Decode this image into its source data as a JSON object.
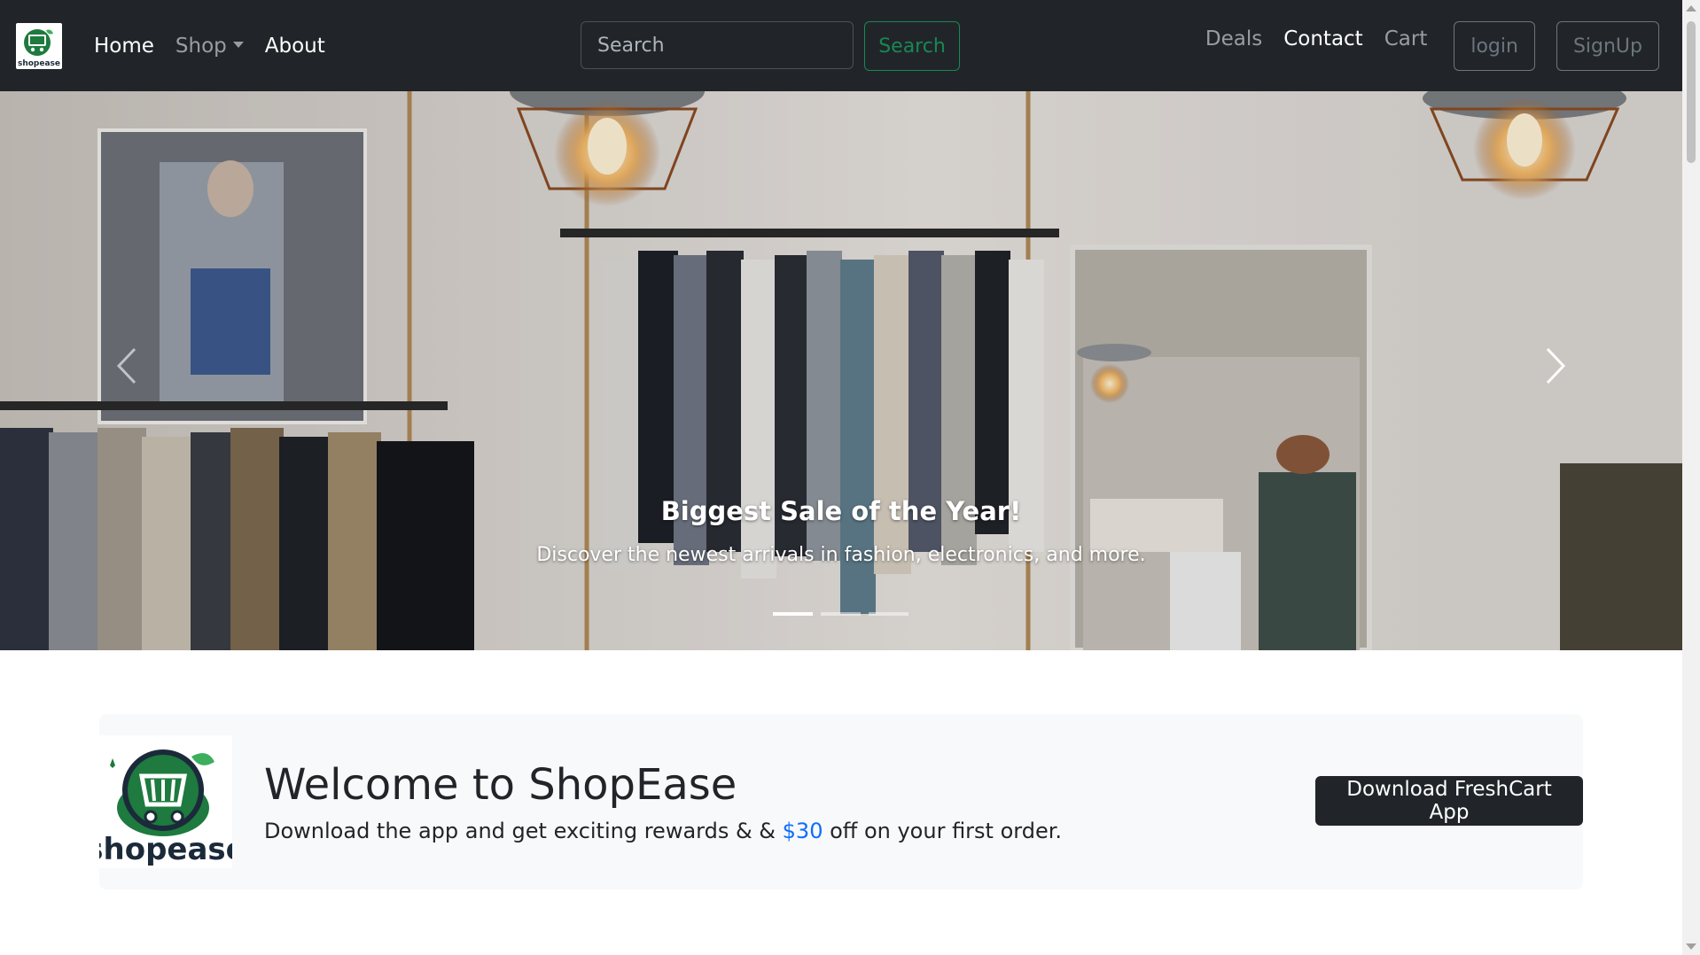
{
  "navbar": {
    "brand_name": "shopease",
    "links": {
      "home": "Home",
      "shop": "Shop",
      "about": "About"
    },
    "search": {
      "placeholder": "Search",
      "button_label": "Search"
    },
    "right_links": {
      "deals": "Deals",
      "contact": "Contact",
      "cart": "Cart"
    },
    "buttons": {
      "login": "login",
      "signup": "SignUp"
    }
  },
  "carousel": {
    "caption_title": "Biggest Sale of the Year!",
    "caption_text": "Discover the newest arrivals in fashion, electronics, and more.",
    "slide_count": 3,
    "active_slide": 1
  },
  "welcome": {
    "logo_text": "shopease",
    "title": "Welcome to ShopEase",
    "text_before": "Download the app and get exciting rewards & & ",
    "amount": "$30",
    "text_after": " off on your first order.",
    "button_label": "Download FreshCart App"
  },
  "colors": {
    "navbar_bg": "#212529",
    "success": "#198754",
    "link_blue": "#0d6efd",
    "brand_green": "#1e7a3e"
  }
}
